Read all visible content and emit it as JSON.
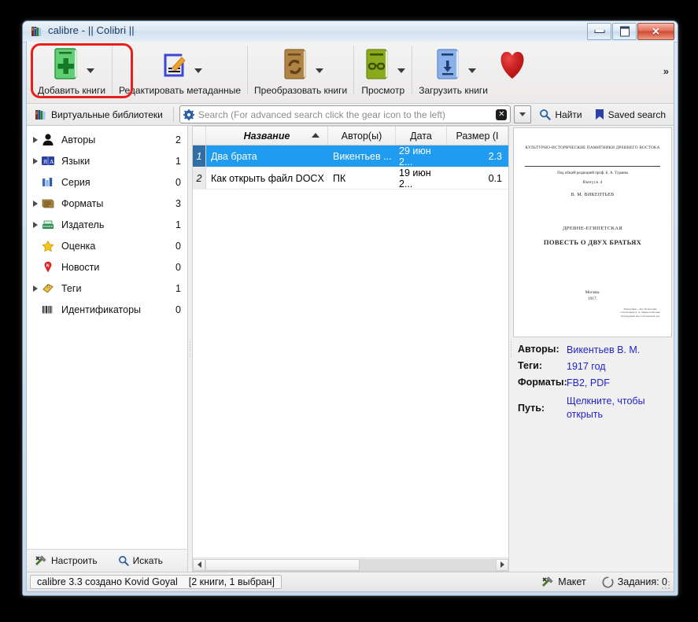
{
  "window": {
    "title": "calibre - || Colibri ||",
    "icon": "calibre-books-icon",
    "minimize_label": "Minimize",
    "maximize_label": "Maximize",
    "close_label": "Close"
  },
  "toolbar": {
    "overflow_label": "»",
    "items": [
      {
        "label": "Добавить книги",
        "icon": "add-books-icon",
        "has_arrow": true,
        "highlighted": true
      },
      {
        "label": "Редактировать метаданные",
        "icon": "edit-metadata-icon",
        "has_arrow": true,
        "highlighted": false
      },
      {
        "label": "Преобразовать книги",
        "icon": "convert-books-icon",
        "has_arrow": true,
        "highlighted": false
      },
      {
        "label": "Просмотр",
        "icon": "view-book-icon",
        "has_arrow": true,
        "highlighted": false
      },
      {
        "label": "Загрузить книги",
        "icon": "download-books-icon",
        "has_arrow": true,
        "highlighted": false
      },
      {
        "label": "",
        "icon": "heart-icon",
        "has_arrow": false,
        "highlighted": false
      }
    ]
  },
  "search": {
    "virtual_library_label": "Виртуальные библиотеки",
    "virtual_library_icon": "books-icon",
    "placeholder": "Search (For advanced search click the gear icon to the left)",
    "value": "",
    "gear_icon": "gear-icon",
    "clear_icon": "clear-icon",
    "dropdown_icon": "chevron-down-icon",
    "find_label": "Найти",
    "find_icon": "magnifier-icon",
    "saved_search_label": "Saved search",
    "saved_search_icon": "bookmark-icon"
  },
  "sidebar": {
    "items": [
      {
        "label": "Авторы",
        "count": "2",
        "expandable": true,
        "icon": "person-icon"
      },
      {
        "label": "Языки",
        "count": "1",
        "expandable": true,
        "icon": "languages-icon"
      },
      {
        "label": "Серия",
        "count": "0",
        "expandable": false,
        "icon": "series-icon"
      },
      {
        "label": "Форматы",
        "count": "3",
        "expandable": true,
        "icon": "formats-icon"
      },
      {
        "label": "Издатель",
        "count": "1",
        "expandable": true,
        "icon": "publisher-icon"
      },
      {
        "label": "Оценка",
        "count": "0",
        "expandable": false,
        "icon": "star-icon"
      },
      {
        "label": "Новости",
        "count": "0",
        "expandable": false,
        "icon": "news-icon"
      },
      {
        "label": "Теги",
        "count": "1",
        "expandable": true,
        "icon": "tag-icon"
      },
      {
        "label": "Идентификаторы",
        "count": "0",
        "expandable": false,
        "icon": "barcode-icon"
      }
    ],
    "configure_label": "Настроить",
    "configure_icon": "wrench-icon",
    "search_label": "Искать",
    "search_icon": "magnifier-icon"
  },
  "booklist": {
    "columns": [
      {
        "key": "idx",
        "label": ""
      },
      {
        "key": "title",
        "label": "Название",
        "sorted": true,
        "sort_dir": "asc"
      },
      {
        "key": "author",
        "label": "Автор(ы)"
      },
      {
        "key": "date",
        "label": "Дата"
      },
      {
        "key": "size",
        "label": "Размер (I"
      }
    ],
    "rows": [
      {
        "idx": "1",
        "title": "Два брата",
        "author": "Викентьев ...",
        "date": "29 июн 2...",
        "size": "2.3",
        "selected": true
      },
      {
        "idx": "2",
        "title": "Как открыть файл DOCX",
        "author": "ПК",
        "date": "19 июн 2...",
        "size": "0.1",
        "selected": false
      }
    ]
  },
  "details": {
    "cover": {
      "series_line": "КУЛЬТУРНО-ИСТОРИЧЕСКИЕ ПАМЯТНИКИ ДРЕВНЕГО ВОСТОКА",
      "editor_line": "Под общей редакцией проф. Б. А. Тураева",
      "issue": "Выпуск 4",
      "author": "В. М. ВИКЕНТЬЕВ",
      "subtitle": "ДРЕВНЕ-ЕГИПЕТСКАЯ",
      "title": "ПОВЕСТЬ О ДВУХ БРАТЬЯХ",
      "place_year": "Москва.\n1917.",
      "imprint": "Типография ... Бог. Вознесение отпечатанная А. А. Левенсон Москва Трехпрудный пер. Собственный дом"
    },
    "fields": [
      {
        "key": "Авторы:",
        "value": "Викентьев В. М."
      },
      {
        "key": "Теги:",
        "value": "1917 год"
      },
      {
        "key": "Форматы:",
        "value": "FB2, PDF"
      },
      {
        "key": "Путь:",
        "value": "Щелкните, чтобы открыть"
      }
    ]
  },
  "status": {
    "version_text": "calibre 3.3 создано Kovid Goyal",
    "selection_text": "[2 книги, 1 выбран]",
    "layout_label": "Макет",
    "layout_icon": "wrench-icon",
    "jobs_label": "Задания: 0",
    "jobs_icon": "spinner-icon"
  },
  "colors": {
    "highlight_ring": "#e8201b",
    "row_selection": "#1f9bf0",
    "link": "#2222cc",
    "title_text": "#1b3a63"
  }
}
